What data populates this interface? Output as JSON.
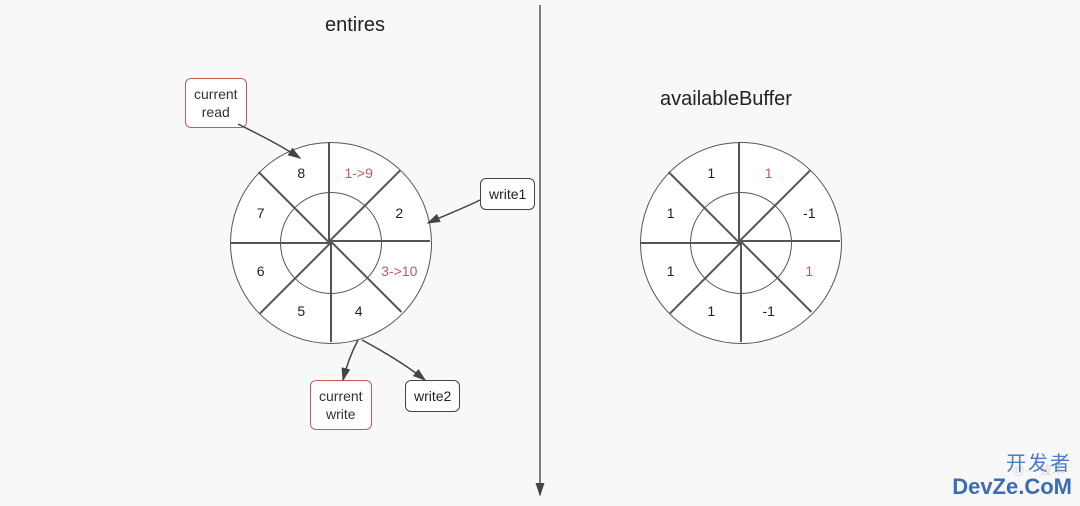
{
  "left": {
    "title": "entires",
    "boxes": {
      "current_read": "current\nread",
      "write1": "write1",
      "current_write": "current\nwrite",
      "write2": "write2"
    },
    "segments": [
      {
        "label": "1->9",
        "highlight": true
      },
      {
        "label": "2",
        "highlight": false
      },
      {
        "label": "3->10",
        "highlight": true
      },
      {
        "label": "4",
        "highlight": false
      },
      {
        "label": "5",
        "highlight": false
      },
      {
        "label": "6",
        "highlight": false
      },
      {
        "label": "7",
        "highlight": false
      },
      {
        "label": "8",
        "highlight": false
      }
    ]
  },
  "right": {
    "title": "availableBuffer",
    "segments": [
      {
        "label": "1",
        "highlight": true
      },
      {
        "label": "-1",
        "highlight": false
      },
      {
        "label": "1",
        "highlight": true
      },
      {
        "label": "-1",
        "highlight": false
      },
      {
        "label": "1",
        "highlight": false
      },
      {
        "label": "1",
        "highlight": false
      },
      {
        "label": "1",
        "highlight": false
      },
      {
        "label": "1",
        "highlight": false
      }
    ]
  },
  "watermark": {
    "cn": "开发者",
    "en": "DevZe.CoM"
  },
  "chart_data": [
    {
      "type": "pie",
      "title": "entires",
      "categories": [
        "1->9",
        "2",
        "3->10",
        "4",
        "5",
        "6",
        "7",
        "8"
      ],
      "values": [
        1,
        1,
        1,
        1,
        1,
        1,
        1,
        1
      ],
      "annotations": [
        "current read -> 8",
        "write1 -> 2",
        "current write -> 4",
        "write2 -> 4"
      ]
    },
    {
      "type": "pie",
      "title": "availableBuffer",
      "categories": [
        "1",
        "-1",
        "1",
        "-1",
        "1",
        "1",
        "1",
        "1"
      ],
      "values": [
        1,
        1,
        1,
        1,
        1,
        1,
        1,
        1
      ]
    }
  ]
}
